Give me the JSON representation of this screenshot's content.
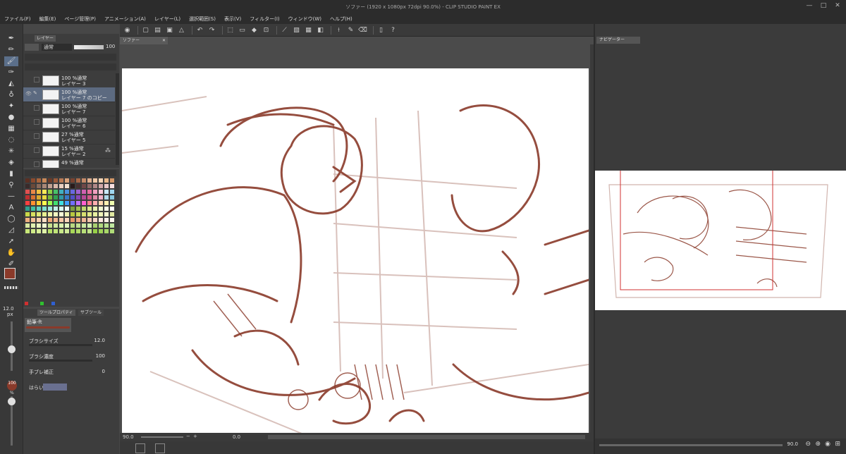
{
  "window": {
    "title": "ソファー (1920 x 1080px 72dpi 90.0%) - CLIP STUDIO PAINT EX",
    "controls": [
      "—",
      "□",
      "✕"
    ]
  },
  "menu": [
    "ファイル(F)",
    "編集(E)",
    "ページ管理(P)",
    "アニメーション(A)",
    "レイヤー(L)",
    "選択範囲(S)",
    "表示(V)",
    "フィルター(I)",
    "ウィンドウ(W)",
    "ヘルプ(H)"
  ],
  "layer_panel": {
    "tab": "レイヤー",
    "blend_mode": "通常",
    "opacity": "100",
    "layers": [
      {
        "line1": "100 %通常",
        "line2": "レイヤー 3",
        "selected": false
      },
      {
        "line1": "100 %通常",
        "line2": "レイヤー 7 のコピー",
        "selected": true
      },
      {
        "line1": "100 %通常",
        "line2": "レイヤー 7",
        "selected": false
      },
      {
        "line1": "100 %通常",
        "line2": "レイヤー 6",
        "selected": false
      },
      {
        "line1": "27 %通常",
        "line2": "レイヤー 5",
        "selected": false
      },
      {
        "line1": "15 %通常",
        "line2": "レイヤー 2",
        "selected": false
      },
      {
        "line1": "49 %通常",
        "line2": "",
        "selected": false
      }
    ]
  },
  "palette": {
    "colors": [
      "#5a2f22",
      "#8b4a2e",
      "#a8643c",
      "#c98a5a",
      "#6b3a28",
      "#9a5a3a",
      "#b87a55",
      "#d9a27a",
      "#7a4330",
      "#a86848",
      "#c58a68",
      "#e0b090",
      "#f0c8a8",
      "#f5d5b5",
      "#e8b88a",
      "#d49868",
      "#3a2a2a",
      "#6a4a3a",
      "#8a6a5a",
      "#a88878",
      "#c0a090",
      "#d8b8a8",
      "#e8d0c0",
      "#f0e0d0",
      "#2a1a1a",
      "#4a3030",
      "#704848",
      "#906868",
      "#b08888",
      "#d0a8a8",
      "#e8c8c8",
      "#f8e0e0",
      "#e05050",
      "#e88848",
      "#f0c040",
      "#f8e858",
      "#90d048",
      "#48c068",
      "#40b0c0",
      "#4890e0",
      "#6868e0",
      "#a060d0",
      "#d060b0",
      "#e870a0",
      "#f0a0c0",
      "#f8c8d8",
      "#c8e8f8",
      "#a0d8f0",
      "#c03030",
      "#d87030",
      "#d8a830",
      "#e8d840",
      "#78b838",
      "#30a050",
      "#3098a8",
      "#3878c8",
      "#5050c8",
      "#8848b8",
      "#b84898",
      "#d05888",
      "#e08aa8",
      "#f0b0c8",
      "#b0d8e8",
      "#88c8e0",
      "#ff4040",
      "#ff9030",
      "#ffd030",
      "#ffff50",
      "#a0ff50",
      "#40e070",
      "#40e0e0",
      "#40a0ff",
      "#7070ff",
      "#c070ff",
      "#ff60d0",
      "#ff8090",
      "#ffb0b0",
      "#ffd8b0",
      "#fff0b0",
      "#f0ffb0",
      "#30a090",
      "#40c0a0",
      "#60d0c0",
      "#80e0d0",
      "#a0e8e0",
      "#c0f0e8",
      "#d8f8f0",
      "#f0fff8",
      "#80a040",
      "#a0c050",
      "#c0d870",
      "#d8e890",
      "#e8f0b0",
      "#f0f8d0",
      "#f8fce8",
      "#ffffff",
      "#c8d848",
      "#d8e060",
      "#e0e878",
      "#e8f090",
      "#f0f4a8",
      "#f4f8c0",
      "#f8fcd8",
      "#ecf0b0",
      "#b8c840",
      "#c8d858",
      "#d8e070",
      "#e0e888",
      "#e8f0a0",
      "#f0f4b8",
      "#f4f8d0",
      "#e0e8a0",
      "#f0b080",
      "#f4c098",
      "#f8d0b0",
      "#fce0c8",
      "#f0a878",
      "#f4b890",
      "#f8c8a8",
      "#fcd8c0",
      "#e89868",
      "#eca880",
      "#f0b898",
      "#f4c8b0",
      "#f8d8c8",
      "#fce8e0",
      "#fff0e8",
      "#fff8f0",
      "#d8e8a0",
      "#e0f0b0",
      "#e8f4c0",
      "#f0f8d0",
      "#c8e090",
      "#d0e8a0",
      "#d8f0b0",
      "#e0f4c0",
      "#b8d880",
      "#c0e090",
      "#c8e8a0",
      "#d0f0b0",
      "#a8d070",
      "#b0d880",
      "#b8e090",
      "#c0e8a0",
      "#c8e878",
      "#d0ec88",
      "#d8f098",
      "#e0f4a8",
      "#b8e068",
      "#c0e478",
      "#c8e888",
      "#d0ec98",
      "#a8d858",
      "#b0dc68",
      "#b8e078",
      "#c0e488",
      "#98d048",
      "#a0d458",
      "#a8d868",
      "#b0dc78"
    ]
  },
  "tool_property": {
    "tab1": "ツールプロパティ",
    "tab2": "サブツール",
    "brush_name": "鉛筆-ft",
    "rows": [
      {
        "label": "ブラシサイズ",
        "value": "12.0"
      },
      {
        "label": "ブラシ濃度",
        "value": "100"
      },
      {
        "label": "手ブレ補正",
        "value": "0"
      },
      {
        "label": "はらい",
        "value": ""
      }
    ]
  },
  "size_indicator": {
    "size": "12.0",
    "unit": "px",
    "opacity": "100",
    "opacity_unit": "%"
  },
  "canvas": {
    "doc_tab": "ソファー",
    "zoom": "90.0",
    "angle": "0.0"
  },
  "navigator": {
    "tab": "ナビゲーター",
    "zoom": "90.0"
  },
  "colors": {
    "stroke": "#8a3a2a",
    "selection": "#5c6a80",
    "nav_frame": "#d03030"
  }
}
